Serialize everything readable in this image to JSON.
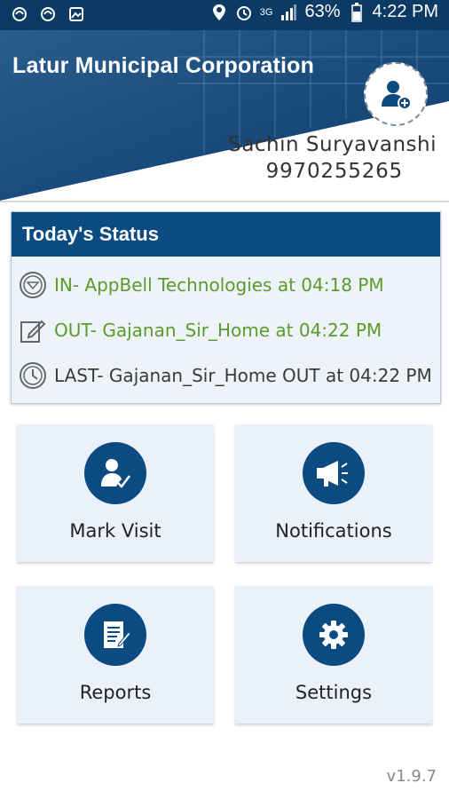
{
  "status_bar": {
    "battery": "63%",
    "time": "4:22 PM",
    "network": "3G"
  },
  "header": {
    "org_title": "Latur Municipal Corporation",
    "user_name": "Sachin Suryavanshi",
    "user_phone": "9970255265"
  },
  "status_card": {
    "title": "Today's Status",
    "in_text": "IN- AppBell Technologies at 04:18 PM",
    "out_text": "OUT- Gajanan_Sir_Home at 04:22 PM",
    "last_text": "LAST- Gajanan_Sir_Home OUT at 04:22 PM"
  },
  "tiles": [
    {
      "label": "Mark Visit",
      "icon": "mark-visit-icon"
    },
    {
      "label": "Notifications",
      "icon": "megaphone-icon"
    },
    {
      "label": "Reports",
      "icon": "report-icon"
    },
    {
      "label": "Settings",
      "icon": "gear-icon"
    }
  ],
  "version": "v1.9.7",
  "colors": {
    "primary": "#0c4a82",
    "status_bar": "#0b3a64",
    "in_out_green": "#5b9b2c",
    "tile_bg": "#eaf1fa"
  }
}
